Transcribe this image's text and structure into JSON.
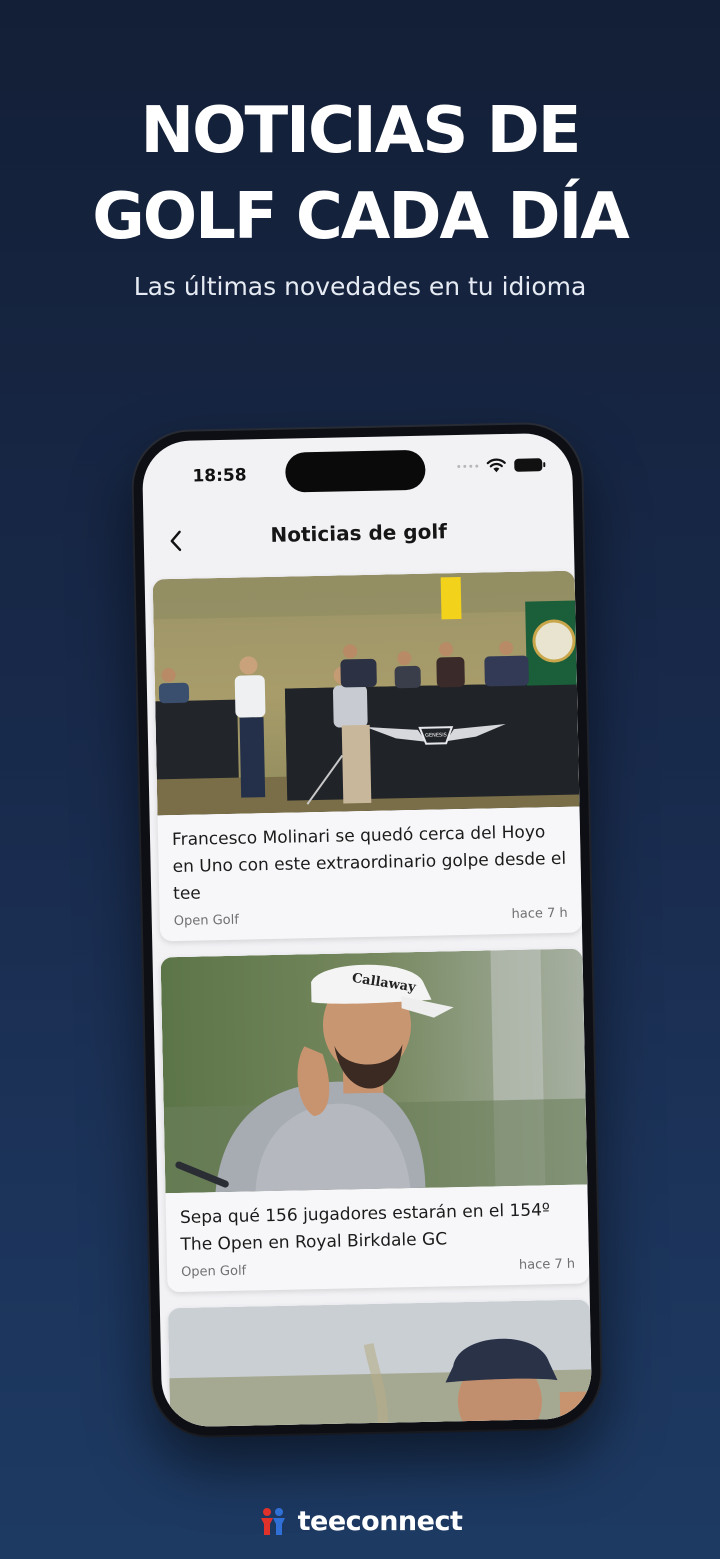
{
  "hero": {
    "title_line1": "NOTICIAS DE",
    "title_line2": "GOLF CADA DÍA",
    "subtitle": "Las últimas novedades en tu idioma"
  },
  "status_bar": {
    "time": "18:58",
    "icons": [
      "signal-dots-icon",
      "wifi-icon",
      "battery-icon"
    ]
  },
  "nav": {
    "back_icon": "chevron-left-icon",
    "title": "Noticias de golf"
  },
  "feed": {
    "articles": [
      {
        "title": "Francesco Molinari se quedó cerca del Hoyo en Uno con este extraordinario golpe desde el tee",
        "source": "Open Golf",
        "time": "hace 7 h",
        "image_brand_text": "GENESIS"
      },
      {
        "title": "Sepa qué 156 jugadores estarán en el 154º The Open en Royal Birkdale GC",
        "source": "Open Golf",
        "time": "hace 7 h",
        "image_brand_text": "Callaway"
      }
    ]
  },
  "brand": {
    "name": "teeconnect",
    "logo_icon": "teeconnect-logo-icon"
  },
  "colors": {
    "background_top": "#131f36",
    "background_bottom": "#1d3a63",
    "brand_red": "#e0312b",
    "brand_blue": "#2f6fd6"
  }
}
